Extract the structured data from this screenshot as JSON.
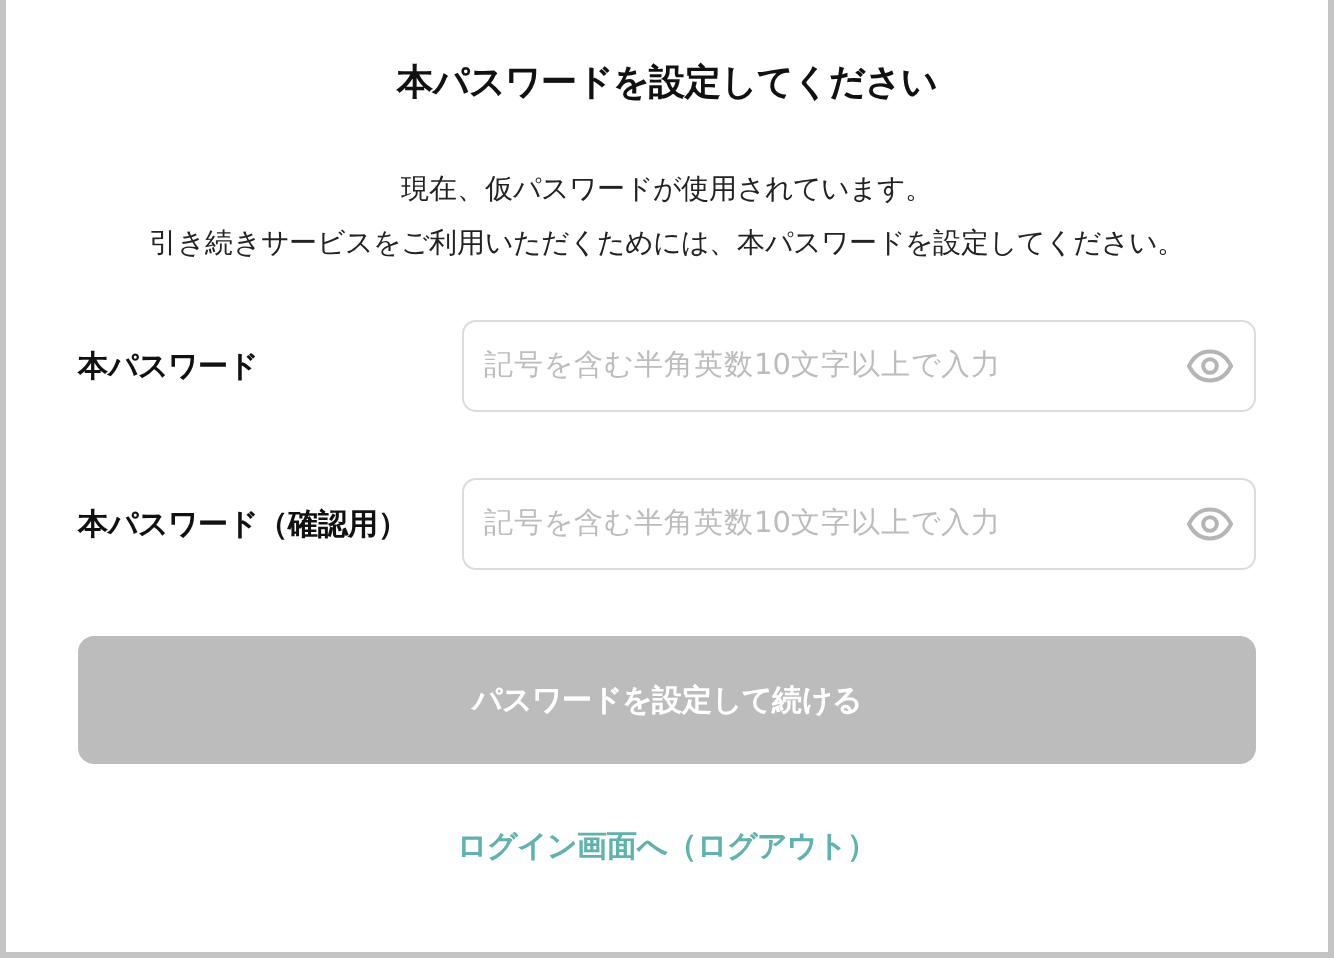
{
  "dialog": {
    "title": "本パスワードを設定してください",
    "message": [
      "現在、仮パスワードが使用されています。",
      "引き続きサービスをご利用いただくためには、本パスワードを設定してください。"
    ],
    "fields": [
      {
        "label": "本パスワード",
        "placeholder": "記号を含む半角英数10文字以上で入力"
      },
      {
        "label": "本パスワード（確認用）",
        "placeholder": "記号を含む半角英数10文字以上で入力"
      }
    ],
    "submit_button": {
      "label": "パスワードを設定して続ける",
      "disabled": true
    },
    "logout_link": "ログイン画面へ（ログアウト）"
  }
}
